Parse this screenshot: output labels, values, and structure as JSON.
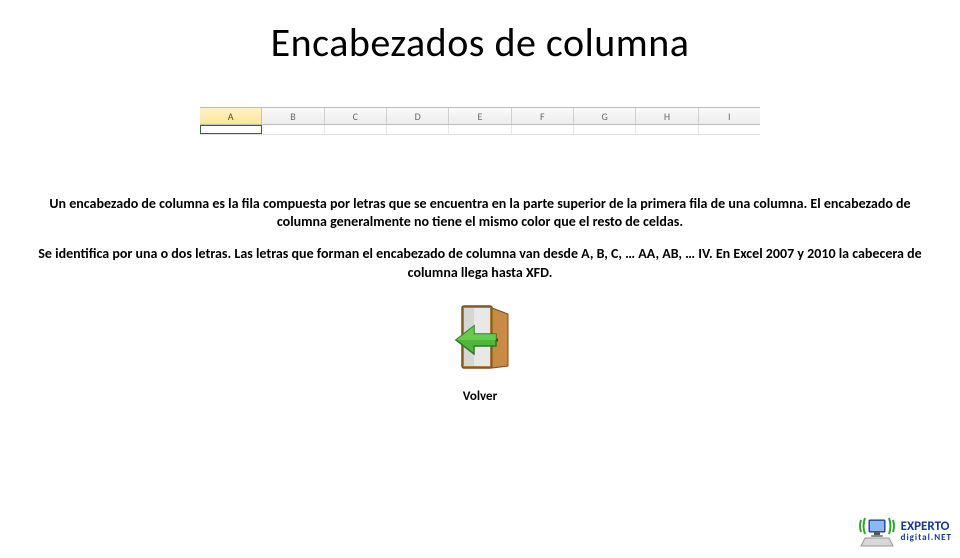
{
  "title": "Encabezados de columna",
  "columns": [
    "A",
    "B",
    "C",
    "D",
    "E",
    "F",
    "G",
    "H",
    "I"
  ],
  "selected_col_index": 0,
  "para1_bold": "Un encabezado de columna",
  "para1_rest": " es la fila compuesta por letras que se encuentra en la parte superior de la primera fila de una columna. El encabezado de columna generalmente no tiene el mismo color que el resto de celdas.",
  "para2": "Se identifica por una o dos letras. Las letras que forman el encabezado de columna van desde A, B, C, … AA, AB, … IV. En Excel 2007 y 2010 la cabecera de columna llega hasta XFD.",
  "volver_label": "Volver",
  "logo_main": "EXPERTO",
  "logo_sub": "digital.NET"
}
